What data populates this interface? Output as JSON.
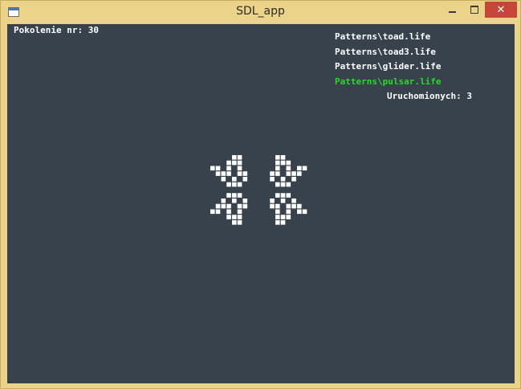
{
  "window": {
    "title": "SDL_app",
    "buttons": {
      "minimize": "minimize-icon",
      "maximize": "maximize-icon",
      "close": "close-icon"
    }
  },
  "colors": {
    "titlebar": "#ecd38a",
    "background": "#37424c",
    "text": "#ffffff",
    "active_pattern": "#22dd22",
    "cell": "#ffffff",
    "close_button": "#c7463a"
  },
  "generation": {
    "label": "Pokolenie nr: 30"
  },
  "patterns": [
    {
      "label": "Patterns\\toad.life",
      "active": false
    },
    {
      "label": "Patterns\\toad3.life",
      "active": false
    },
    {
      "label": "Patterns\\glider.life",
      "active": false
    },
    {
      "label": "Patterns\\pulsar.life",
      "active": true
    }
  ],
  "running": {
    "label": "Uruchomionych: 3"
  },
  "grid": {
    "rows": [
      "....##......##....",
      "...###......###...",
      "##.#.#......#.#.##",
      ".###.##....##.###.",
      "..#.#.#....#.#.#..",
      "...###......###...",
      "..................",
      "...###......###...",
      "..#.#.#....#.#.#..",
      ".###.##....##.###.",
      "##.#.#......#.#.##",
      "...###......###...",
      "....##......##...."
    ]
  }
}
